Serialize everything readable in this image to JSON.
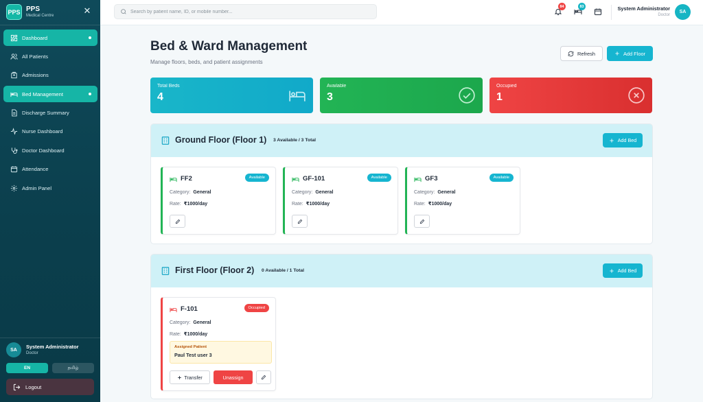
{
  "sidebar": {
    "brand_logo": "PPS",
    "brand_name": "PPS",
    "brand_sub": "Medical Centre",
    "items": [
      {
        "label": "Dashboard",
        "icon": "dashboard-icon",
        "active": true
      },
      {
        "label": "All Patients",
        "icon": "users-icon"
      },
      {
        "label": "Admissions",
        "icon": "hospital-icon"
      },
      {
        "label": "Bed Management",
        "icon": "bed-icon",
        "active": true
      },
      {
        "label": "Discharge Summary",
        "icon": "document-icon"
      },
      {
        "label": "Nurse Dashboard",
        "icon": "activity-icon"
      },
      {
        "label": "Doctor Dashboard",
        "icon": "stethoscope-icon"
      },
      {
        "label": "Attendance",
        "icon": "calendar-icon"
      },
      {
        "label": "Admin Panel",
        "icon": "gear-icon"
      }
    ],
    "user": {
      "initials": "SA",
      "name": "System Administrator",
      "role": "Doctor"
    },
    "lang_en": "EN",
    "lang_ta": "தமிழ்",
    "logout": "Logout"
  },
  "header": {
    "search_placeholder": "Search by patient name, ID, or mobile number...",
    "notifications_count": "84",
    "beds_count": "83",
    "user_name": "System Administrator",
    "user_role": "Doctor",
    "user_initials": "SA"
  },
  "page": {
    "title": "Bed & Ward Management",
    "subtitle": "Manage floors, beds, and patient assignments",
    "refresh_label": "Refresh",
    "add_floor_label": "Add Floor"
  },
  "stats": {
    "total": {
      "label": "Total Beds",
      "value": "4"
    },
    "available": {
      "label": "Available",
      "value": "3"
    },
    "occupied": {
      "label": "Occupied",
      "value": "1"
    }
  },
  "floors": [
    {
      "title": "Ground Floor (Floor 1)",
      "count": "3 Available / 3 Total",
      "add_bed_label": "Add Bed",
      "beds": [
        {
          "name": "FF2",
          "status": "Available",
          "category_label": "Category:",
          "category": "General",
          "rate_label": "Rate:",
          "rate": "₹1000/day"
        },
        {
          "name": "GF-101",
          "status": "Available",
          "category_label": "Category:",
          "category": "General",
          "rate_label": "Rate:",
          "rate": "₹1000/day"
        },
        {
          "name": "GF3",
          "status": "Available",
          "category_label": "Category:",
          "category": "General",
          "rate_label": "Rate:",
          "rate": "₹1000/day"
        }
      ]
    },
    {
      "title": "First Floor (Floor 2)",
      "count": "0 Available / 1 Total",
      "add_bed_label": "Add Bed",
      "beds": [
        {
          "name": "F-101",
          "status": "Occupied",
          "category_label": "Category:",
          "category": "General",
          "rate_label": "Rate:",
          "rate": "₹1000/day",
          "assigned_label": "Assigned Patient",
          "patient": "Paul Test user 3",
          "transfer_label": "Transfer",
          "unassign_label": "Unassign"
        }
      ]
    }
  ],
  "colors": {
    "sidebar": "#0f4a5a",
    "accent_teal": "#16b5a6",
    "accent_cyan": "#16b5d0",
    "available": "#22b455",
    "occupied": "#ef4444"
  }
}
